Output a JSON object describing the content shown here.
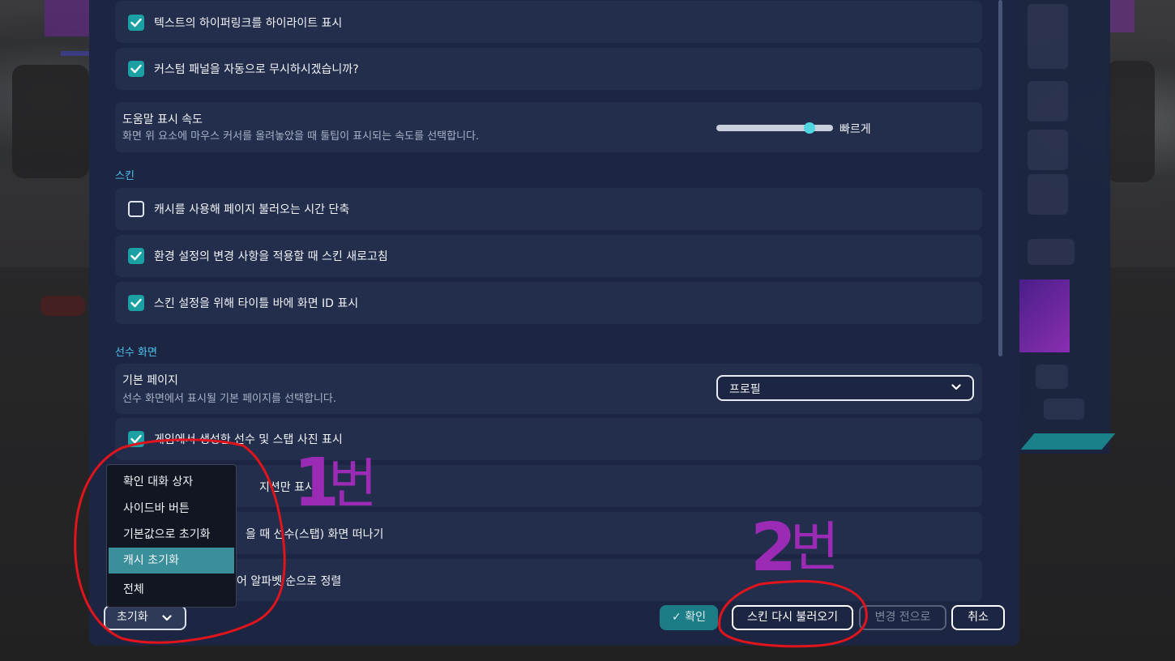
{
  "settings": {
    "general": {
      "highlight_links": {
        "label": "텍스트의 하이퍼링크를 하이라이트 표시",
        "checked": true
      },
      "ignore_custom_panel": {
        "label": "커스텀 패널을 자동으로 무시하시겠습니까?",
        "checked": true
      },
      "tooltip_speed": {
        "title": "도움말 표시 속도",
        "description": "화면 위 요소에 마우스 커서를 올려놓았을 때 툴팁이 표시되는 속도를 선택합니다.",
        "value_label": "빠르게",
        "slider_level": 0.8
      }
    },
    "skin": {
      "section_label": "스킨",
      "cache": {
        "label": "캐시를 사용해 페이지 불러오는 시간 단축",
        "checked": false
      },
      "refresh_on_change": {
        "label": "환경 설정의 변경 사항을 적용할 때 스킨 새로고침",
        "checked": true
      },
      "show_screen_id": {
        "label": "스킨 설정을 위해 타이틀 바에 화면 ID 표시",
        "checked": true
      }
    },
    "player_screen": {
      "section_label": "선수 화면",
      "default_page": {
        "title": "기본 페이지",
        "description": "선수 화면에서 표시될 기본 페이지를 선택합니다.",
        "selected": "프로필"
      },
      "show_generated_photos": {
        "label": "게임에서 생성한 선수 및 스탭 사진 표시",
        "checked": true
      },
      "partial_row_1": {
        "label": "지션만 표시"
      },
      "partial_row_2": {
        "label": "을 때 선수(스탭) 화면 떠나기"
      },
      "partial_row_3": {
        "label": "어 알파벳 순으로 정렬"
      }
    }
  },
  "reset_menu": {
    "items": [
      "확인 대화 상자",
      "사이드바 버튼",
      "기본값으로 초기화",
      "캐시 초기화",
      "전체"
    ],
    "selected_index": 3
  },
  "buttons": {
    "reset": "초기화",
    "confirm": "✓ 확인",
    "reload_skin": "스킨 다시 불러오기",
    "revert": "변경 전으로",
    "cancel": "취소"
  },
  "annotations": {
    "mark1_num": "1",
    "mark1_text": "번",
    "mark2_num": "2",
    "mark2_text": "번",
    "color": "#9b2bb5",
    "circle_color": "#e0141c"
  },
  "colors": {
    "accent": "#1ba0a3",
    "section": "#4cc3f0",
    "dialog_bg": "#1c2642",
    "row_bg": "#232e4c"
  }
}
